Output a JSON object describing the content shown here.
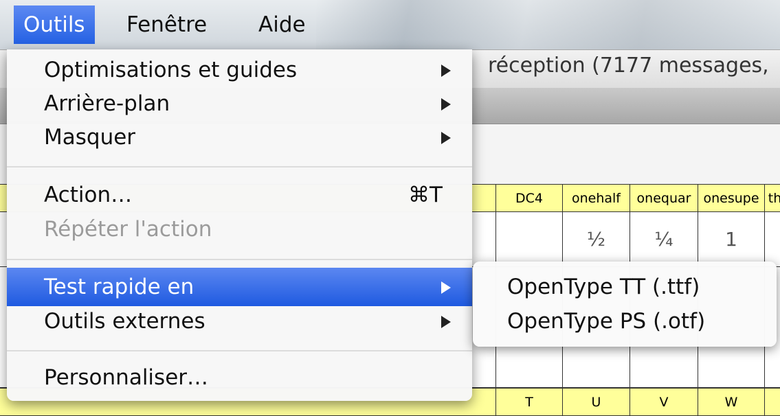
{
  "menubar": {
    "items": [
      {
        "label": "Outils"
      },
      {
        "label": "Fenêtre"
      },
      {
        "label": "Aide"
      }
    ]
  },
  "background_window": {
    "title": "réception (7177 messages,",
    "glyph_table": {
      "header_row": [
        "DC4",
        "onehalf",
        "onequar",
        "onesupe",
        "th"
      ],
      "glyph_row": [
        "",
        "½",
        "¼",
        "1",
        ""
      ],
      "lower_header_row": [
        "T",
        "U",
        "V",
        "W",
        ""
      ]
    }
  },
  "menu": {
    "items": [
      {
        "label": "Optimisations et guides",
        "submenu": true
      },
      {
        "label": "Arrière-plan",
        "submenu": true
      },
      {
        "label": "Masquer",
        "submenu": true
      },
      {
        "label": "Action…",
        "shortcut": "⌘T"
      },
      {
        "label": "Répéter l'action",
        "disabled": true
      },
      {
        "label": "Test rapide en",
        "submenu": true,
        "highlighted": true
      },
      {
        "label": "Outils externes",
        "submenu": true
      },
      {
        "label": "Personnaliser…"
      }
    ]
  },
  "submenu": {
    "items": [
      {
        "label": "OpenType TT (.ttf)"
      },
      {
        "label": "OpenType PS (.otf)"
      }
    ]
  },
  "colors": {
    "highlight": "#2561e3",
    "table_header": "#ffff9a"
  }
}
